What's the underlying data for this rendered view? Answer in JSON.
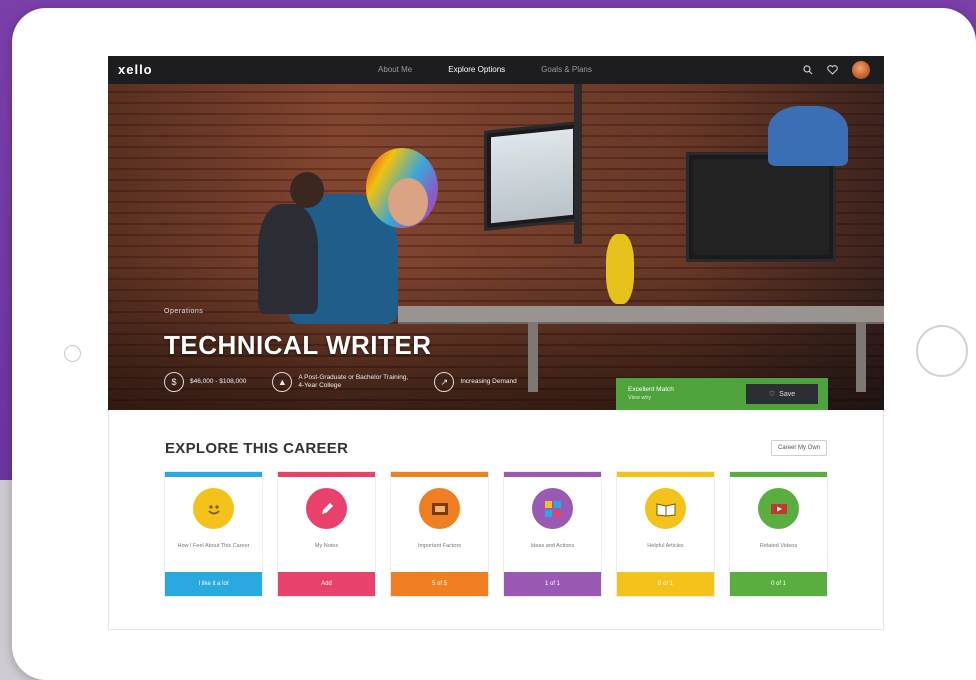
{
  "app": {
    "logo": "xello",
    "nav": [
      {
        "label": "About Me",
        "active": false
      },
      {
        "label": "Explore Options",
        "active": true
      },
      {
        "label": "Goals & Plans",
        "active": false
      }
    ],
    "icons": [
      "search-icon",
      "heart-icon",
      "avatar"
    ]
  },
  "hero": {
    "category": "Operations",
    "title": "TECHNICAL WRITER",
    "facts": [
      {
        "icon": "wallet-icon",
        "text": "$46,000 - $108,000"
      },
      {
        "icon": "education-icon",
        "text": "A Post-Graduate or Bachelor Training, 4-Year College"
      },
      {
        "icon": "trend-icon",
        "text": "Increasing Demand"
      }
    ],
    "match": {
      "label": "Excellent Match",
      "sub": "View why",
      "save_label": "Save"
    }
  },
  "explore": {
    "title": "EXPLORE THIS CAREER",
    "compare_label": "Career My Own",
    "cards": [
      {
        "label": "How I Feel About This Career",
        "button": "I like it a lot",
        "color": "#29a9e0",
        "icon": "smiley-icon",
        "icon_bg": "#f3c21b"
      },
      {
        "label": "My Notes",
        "button": "Add",
        "color": "#e8416c",
        "icon": "pencil-icon",
        "icon_bg": "#e8416c"
      },
      {
        "label": "Important Factors",
        "button": "5 of 5",
        "color": "#ef7f22",
        "icon": "factors-icon",
        "icon_bg": "#ef7f22"
      },
      {
        "label": "Ideas and Actions",
        "button": "1 of 1",
        "color": "#9b59b6",
        "icon": "puzzle-icon",
        "icon_bg": "#9b59b6"
      },
      {
        "label": "Helpful Articles",
        "button": "0 of 1",
        "color": "#f3c21b",
        "icon": "book-icon",
        "icon_bg": "#f3c21b"
      },
      {
        "label": "Related Videos",
        "button": "0 of 1",
        "color": "#5aae3f",
        "icon": "video-icon",
        "icon_bg": "#5aae3f"
      }
    ]
  }
}
